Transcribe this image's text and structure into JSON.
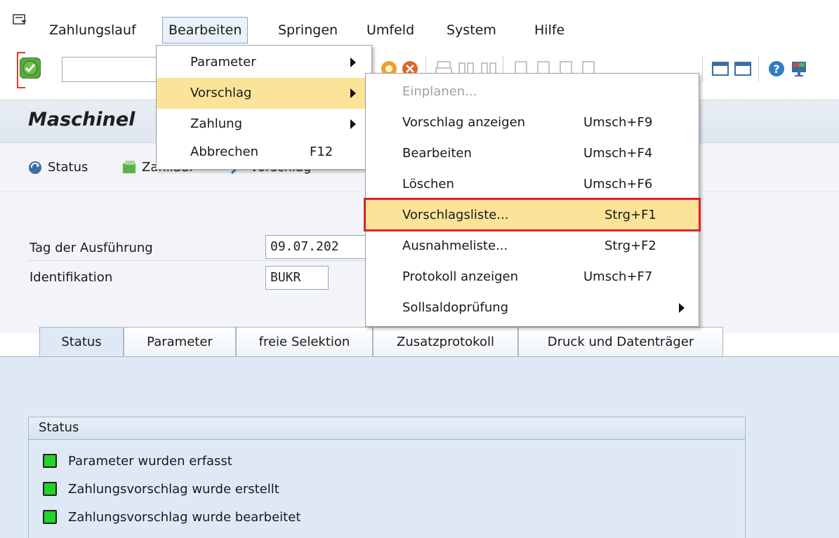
{
  "menubar": {
    "items": [
      {
        "label": "Zahlungslauf"
      },
      {
        "label": "Bearbeiten"
      },
      {
        "label": "Springen"
      },
      {
        "label": "Umfeld"
      },
      {
        "label": "System"
      },
      {
        "label": "Hilfe"
      }
    ]
  },
  "toolbar": {
    "command_value": ""
  },
  "title": "Maschinel",
  "app_toolbar": {
    "status_label": "Status",
    "zahllauf_label": "Zahllauf",
    "vorschlag_label": "Vorschlag"
  },
  "form": {
    "tag_label": "Tag der Ausführung",
    "tag_value": "09.07.202",
    "ident_label": "Identifikation",
    "ident_value": "BUKR"
  },
  "tabs": [
    {
      "label": "Status",
      "active": true
    },
    {
      "label": "Parameter",
      "active": false
    },
    {
      "label": "freie Selektion",
      "active": false
    },
    {
      "label": "Zusatzprotokoll",
      "active": false
    },
    {
      "label": "Druck und Datenträger",
      "active": false
    }
  ],
  "status_group": {
    "title": "Status",
    "rows": [
      {
        "text": "Parameter wurden erfasst",
        "led": "green"
      },
      {
        "text": "Zahlungsvorschlag wurde erstellt",
        "led": "green"
      },
      {
        "text": "Zahlungsvorschlag wurde bearbeitet",
        "led": "green"
      }
    ]
  },
  "menu_bearbeiten": {
    "items": [
      {
        "label": "Parameter",
        "shortcut": "",
        "submenu": true
      },
      {
        "label": "Vorschlag",
        "shortcut": "",
        "submenu": true,
        "highlighted": true
      },
      {
        "label": "Zahlung",
        "shortcut": "",
        "submenu": true
      },
      {
        "label": "Abbrechen",
        "shortcut": "F12",
        "submenu": false
      }
    ]
  },
  "menu_vorschlag": {
    "items": [
      {
        "label": "Einplanen...",
        "shortcut": "",
        "disabled": true
      },
      {
        "label": "Vorschlag anzeigen",
        "shortcut": "Umsch+F9"
      },
      {
        "label": "Bearbeiten",
        "shortcut": "Umsch+F4"
      },
      {
        "label": "Löschen",
        "shortcut": "Umsch+F6"
      },
      {
        "label": "Vorschlagsliste...",
        "shortcut": "Strg+F1",
        "highlighted": true
      },
      {
        "label": "Ausnahmeliste...",
        "shortcut": "Strg+F2"
      },
      {
        "label": "Protokoll anzeigen",
        "shortcut": "Umsch+F7"
      },
      {
        "label": "Sollsaldoprüfung",
        "shortcut": "",
        "submenu": true
      }
    ]
  },
  "colors": {
    "menu_highlight": "#fbe39a",
    "focus_red": "#e21f27",
    "led_green": "#22d32a",
    "panel_blue": "#dfe9f5"
  }
}
